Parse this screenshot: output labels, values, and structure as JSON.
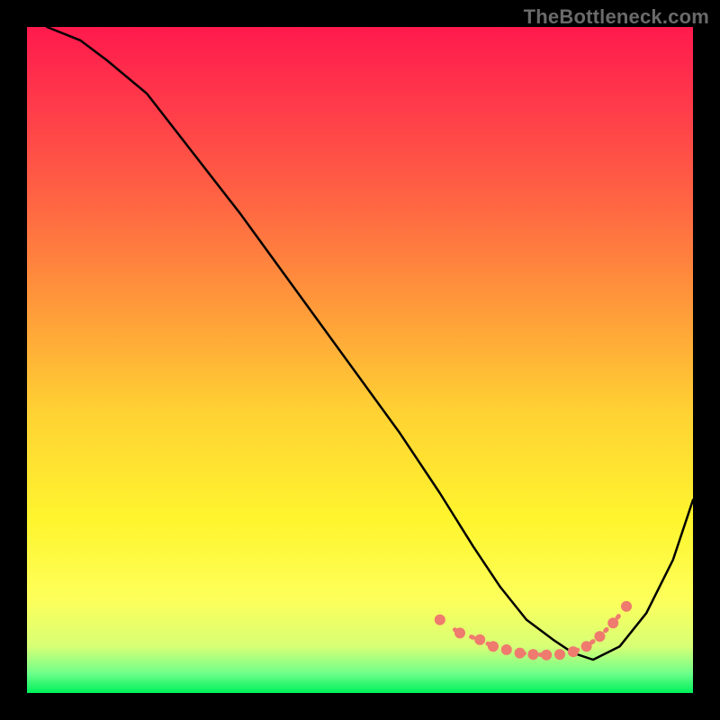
{
  "watermark": "TheBottleneck.com",
  "chart_data": {
    "type": "line",
    "title": "",
    "xlabel": "",
    "ylabel": "",
    "xlim": [
      0,
      100
    ],
    "ylim": [
      0,
      100
    ],
    "series": [
      {
        "name": "curve",
        "x": [
          3,
          8,
          12,
          18,
          25,
          32,
          40,
          48,
          56,
          62,
          67,
          71,
          75,
          79,
          82,
          85,
          89,
          93,
          97,
          100
        ],
        "values": [
          100,
          98,
          95,
          90,
          81,
          72,
          61,
          50,
          39,
          30,
          22,
          16,
          11,
          8,
          6,
          5,
          7,
          12,
          20,
          29
        ]
      }
    ],
    "highlight_points": {
      "x": [
        62,
        65,
        68,
        70,
        72,
        74,
        76,
        78,
        80,
        82,
        84,
        86,
        88,
        90
      ],
      "values": [
        11,
        9,
        8,
        7,
        6.5,
        6,
        5.8,
        5.7,
        5.8,
        6.2,
        7,
        8.5,
        10.5,
        13
      ]
    },
    "colors": {
      "curve": "#000000",
      "highlight": "#ef7a6e"
    }
  }
}
